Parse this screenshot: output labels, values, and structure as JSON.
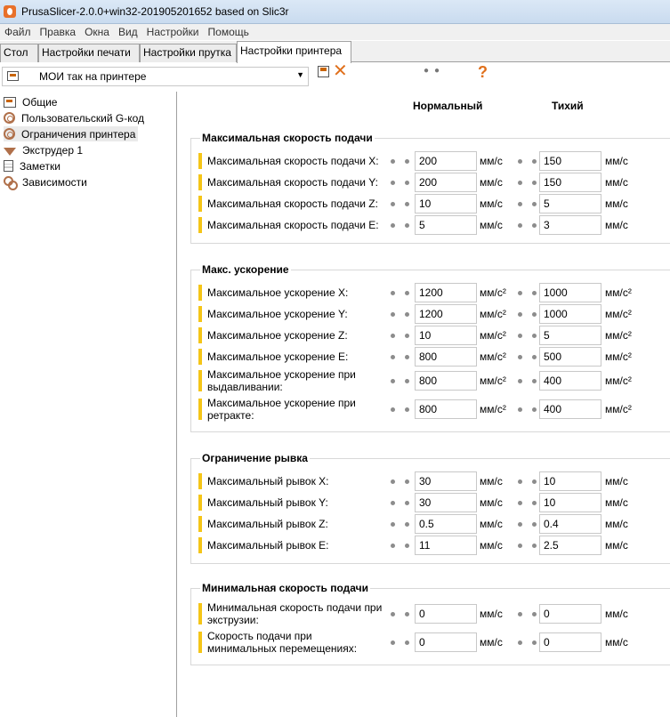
{
  "window": {
    "title": "PrusaSlicer-2.0.0+win32-201905201652 based on Slic3r"
  },
  "menu": [
    "Файл",
    "Правка",
    "Окна",
    "Вид",
    "Настройки",
    "Помощь"
  ],
  "tabs": [
    {
      "label": "Стол",
      "active": false
    },
    {
      "label": "Настройки печати",
      "active": false
    },
    {
      "label": "Настройки прутка",
      "active": false
    },
    {
      "label": "Настройки принтера",
      "active": true
    }
  ],
  "preset": {
    "value": "МОИ так на принтере"
  },
  "sidebar": {
    "items": [
      {
        "label": "Общие",
        "icon": "general-icon"
      },
      {
        "label": "Пользовательский G-код",
        "icon": "gear-icon"
      },
      {
        "label": "Ограничения принтера",
        "icon": "gear-icon",
        "selected": true
      },
      {
        "label": "Экструдер 1",
        "icon": "funnel-icon"
      },
      {
        "label": "Заметки",
        "icon": "notes-icon"
      },
      {
        "label": "Зависимости",
        "icon": "dependencies-icon"
      }
    ]
  },
  "columns": {
    "normal": "Нормальный",
    "silent": "Тихий"
  },
  "groups": [
    {
      "title": "Максимальная скорость подачи",
      "rows": [
        {
          "label": [
            "Максимальная скорость подачи X:"
          ],
          "v1": "200",
          "u1": "мм/с",
          "v2": "150",
          "u2": "мм/с"
        },
        {
          "label": [
            "Максимальная скорость подачи Y:"
          ],
          "v1": "200",
          "u1": "мм/с",
          "v2": "150",
          "u2": "мм/с"
        },
        {
          "label": [
            "Максимальная скорость подачи Z:"
          ],
          "v1": "10",
          "u1": "мм/с",
          "v2": "5",
          "u2": "мм/с"
        },
        {
          "label": [
            "Максимальная скорость подачи E:"
          ],
          "v1": "5",
          "u1": "мм/с",
          "v2": "3",
          "u2": "мм/с"
        }
      ]
    },
    {
      "title": "Макс. ускорение",
      "rows": [
        {
          "label": [
            "Максимальное ускорение X:"
          ],
          "v1": "1200",
          "u1": "мм/с²",
          "v2": "1000",
          "u2": "мм/с²"
        },
        {
          "label": [
            "Максимальное ускорение Y:"
          ],
          "v1": "1200",
          "u1": "мм/с²",
          "v2": "1000",
          "u2": "мм/с²"
        },
        {
          "label": [
            "Максимальное ускорение Z:"
          ],
          "v1": "10",
          "u1": "мм/с²",
          "v2": "5",
          "u2": "мм/с²"
        },
        {
          "label": [
            "Максимальное ускорение E:"
          ],
          "v1": "800",
          "u1": "мм/с²",
          "v2": "500",
          "u2": "мм/с²"
        },
        {
          "label": [
            "Максимальное ускорение при",
            "выдавливании:"
          ],
          "v1": "800",
          "u1": "мм/с²",
          "v2": "400",
          "u2": "мм/с²"
        },
        {
          "label": [
            "Максимальное ускорение при",
            "ретракте:"
          ],
          "v1": "800",
          "u1": "мм/с²",
          "v2": "400",
          "u2": "мм/с²"
        }
      ]
    },
    {
      "title": "Ограничение рывка",
      "rows": [
        {
          "label": [
            "Максимальный рывок X:"
          ],
          "v1": "30",
          "u1": "мм/с",
          "v2": "10",
          "u2": "мм/с"
        },
        {
          "label": [
            "Максимальный рывок Y:"
          ],
          "v1": "30",
          "u1": "мм/с",
          "v2": "10",
          "u2": "мм/с"
        },
        {
          "label": [
            "Максимальный рывок Z:"
          ],
          "v1": "0.5",
          "u1": "мм/с",
          "v2": "0.4",
          "u2": "мм/с"
        },
        {
          "label": [
            "Максимальный рывок E:"
          ],
          "v1": "11",
          "u1": "мм/с",
          "v2": "2.5",
          "u2": "мм/с"
        }
      ]
    },
    {
      "title": "Минимальная скорость подачи",
      "rows": [
        {
          "label": [
            "Минимальная скорость подачи при",
            "экструзии:"
          ],
          "v1": "0",
          "u1": "мм/с",
          "v2": "0",
          "u2": "мм/с"
        },
        {
          "label": [
            "Скорость подачи при",
            "минимальных перемещениях:"
          ],
          "v1": "0",
          "u1": "мм/с",
          "v2": "0",
          "u2": "мм/с"
        }
      ]
    }
  ],
  "colors": {
    "accent": "#e0701c",
    "modified_bar": "#f5c518"
  }
}
